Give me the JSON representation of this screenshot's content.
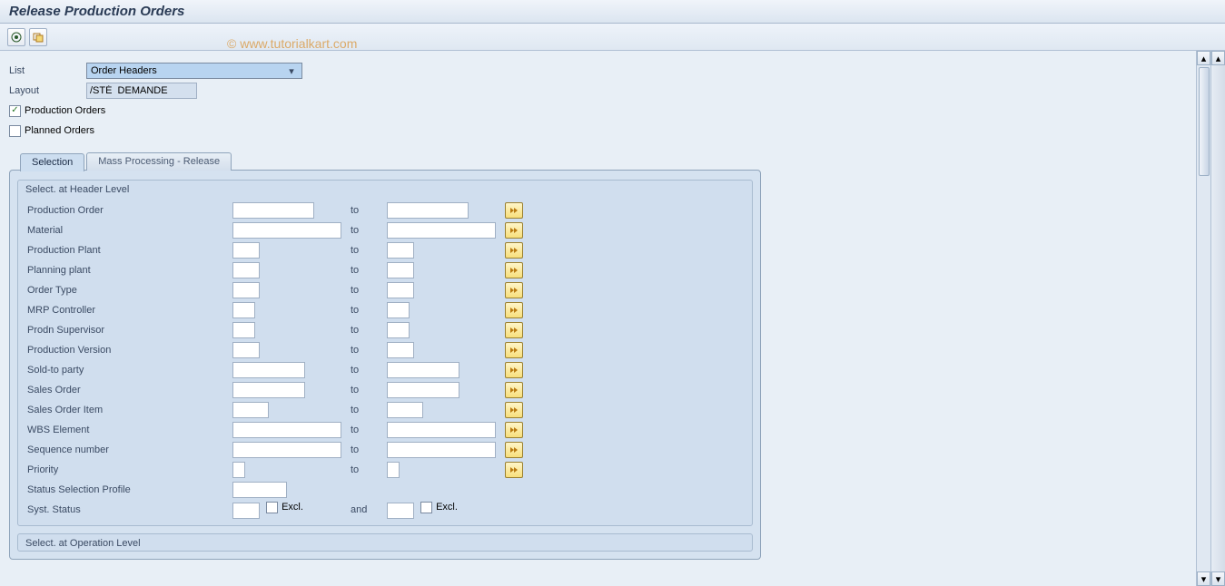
{
  "title": "Release Production Orders",
  "watermark": "© www.tutorialkart.com",
  "top": {
    "list_label": "List",
    "list_value": "Order Headers",
    "layout_label": "Layout",
    "layout_value": "/STÉ  DEMANDE",
    "chk_production": "Production Orders",
    "chk_planned": "Planned Orders"
  },
  "tabs": {
    "selection": "Selection",
    "mass": "Mass Processing - Release"
  },
  "group_header": "Select. at Header Level",
  "group_op": "Select. at Operation Level",
  "to_label": "to",
  "and_label": "and",
  "excl_label": "Excl.",
  "rows": {
    "prod_order": "Production Order",
    "material": "Material",
    "prod_plant": "Production Plant",
    "plan_plant": "Planning plant",
    "order_type": "Order Type",
    "mrp": "MRP Controller",
    "supervisor": "Prodn Supervisor",
    "version": "Production Version",
    "soldto": "Sold-to party",
    "sales_order": "Sales Order",
    "sales_item": "Sales Order Item",
    "wbs": "WBS Element",
    "seq": "Sequence number",
    "priority": "Priority",
    "status_profile": "Status Selection Profile",
    "syst_status": "Syst. Status"
  }
}
